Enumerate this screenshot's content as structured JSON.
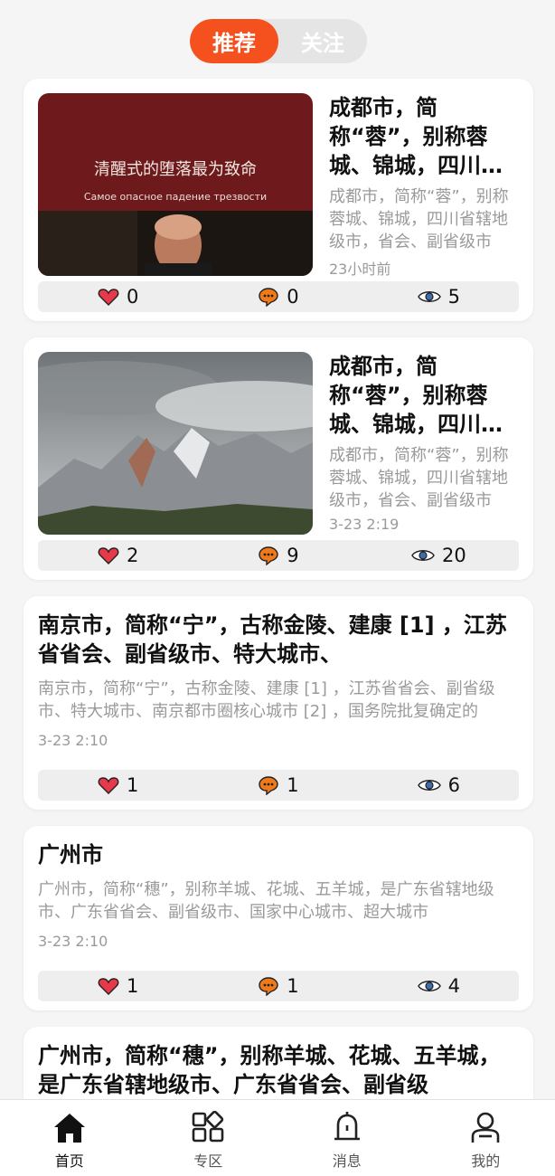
{
  "tabs": [
    {
      "label": "推荐",
      "active": true
    },
    {
      "label": "关注",
      "active": false
    }
  ],
  "colors": {
    "accent": "#f4511e",
    "like": "#e8394a",
    "comment": "#f07a1a"
  },
  "posts": [
    {
      "image": "red-poster-image",
      "image_text_cn": "清醒式的堕落最为致命",
      "image_text_ru": "Самое опасное падение трезвости",
      "title": "成都市，简称“蓉”，别称蓉城、锦城，四川省辖地级市、省会",
      "summary": "成都市，简称“蓉”，别称蓉城、锦城，四川省辖地级市，省会、副省级市",
      "time": "23小时前",
      "likes": "0",
      "comments": "0",
      "views": "5"
    },
    {
      "image": "mountain-image",
      "title": "成都市，简称“蓉”，别称蓉城、锦城，四川省辖地级市、省会",
      "summary": "成都市，简称“蓉”，别称蓉城、锦城，四川省辖地级市，省会、副省级市",
      "time": "3-23 2:19",
      "likes": "2",
      "comments": "9",
      "views": "20"
    },
    {
      "title": "南京市，简称“宁”，古称金陵、建康 [1] ，江苏省省会、副省级市、特大城市、",
      "summary": "南京市，简称“宁”，古称金陵、建康 [1] ，江苏省省会、副省级市、特大城市、南京都市圈核心城市 [2] ，国务院批复确定的",
      "time": "3-23 2:10",
      "likes": "1",
      "comments": "1",
      "views": "6"
    },
    {
      "title": "广州市",
      "summary": "广州市，简称“穗”，别称羊城、花城、五羊城，是广东省辖地级市、广东省省会、副省级市、国家中心城市、超大城市",
      "time": "3-23 2:10",
      "likes": "1",
      "comments": "1",
      "views": "4"
    },
    {
      "title": "广州市，简称“穗”，别称羊城、花城、五羊城，是广东省辖地级市、广东省省会、副省级"
    }
  ],
  "nav": [
    {
      "label": "首页",
      "icon": "home-icon",
      "active": true
    },
    {
      "label": "专区",
      "icon": "grid-icon",
      "active": false
    },
    {
      "label": "消息",
      "icon": "bell-icon",
      "active": false
    },
    {
      "label": "我的",
      "icon": "profile-icon",
      "active": false
    }
  ]
}
